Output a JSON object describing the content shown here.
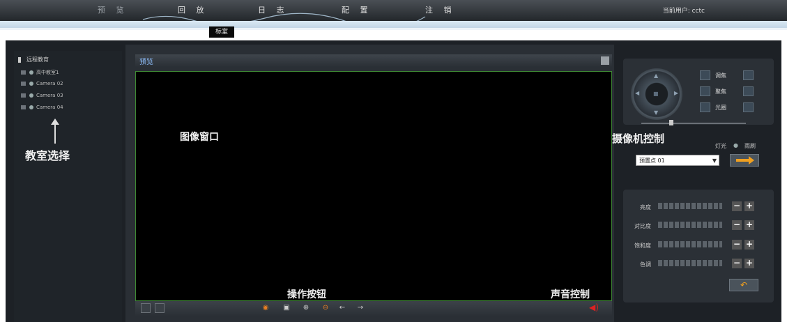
{
  "nav": {
    "items": [
      "预 览",
      "回 放",
      "日 志",
      "配 置",
      "注 销"
    ],
    "user": "当前用户: cctc",
    "tag": "标室"
  },
  "tree": {
    "root": "远程教育",
    "items": [
      "高中教室1",
      "Camera 02",
      "Camera 03",
      "Camera 04"
    ]
  },
  "preview": {
    "title": "预览"
  },
  "ptz": {
    "zoom": "调焦",
    "focus": "聚焦",
    "iris": "光圈",
    "light": "灯光",
    "wiper": "雨刷",
    "preset": "预置点 01"
  },
  "adjust": {
    "labels": [
      "亮度",
      "对比度",
      "饱和度",
      "色调"
    ]
  },
  "annotations": {
    "room_select": "教室选择",
    "image_window": "图像窗口",
    "camera_control": "摄像机控制",
    "op_buttons": "操作按钮",
    "sound_control": "声音控制"
  }
}
